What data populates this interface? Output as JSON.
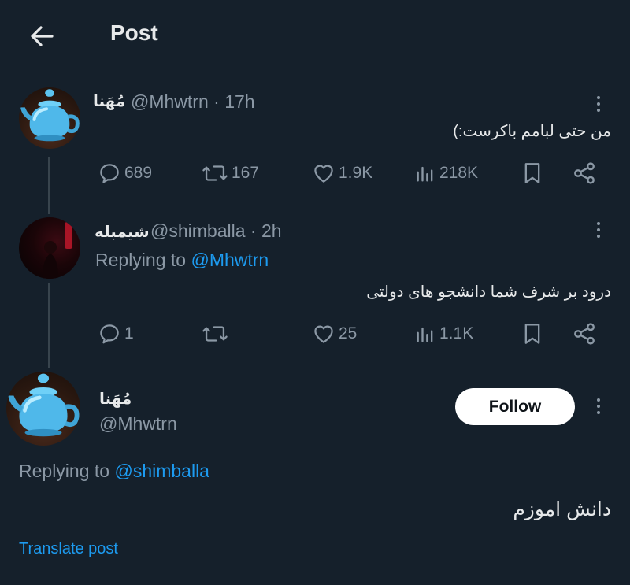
{
  "header": {
    "title": "Post",
    "back_icon": "arrow-left-icon"
  },
  "tweets": [
    {
      "name": "مُهَنا",
      "handle": "@Mhwtrn",
      "time": "· 17h",
      "avatar": "teapot",
      "text": "من حتی لبامم باکرست:)",
      "stats": {
        "replies": "689",
        "reposts": "167",
        "likes": "1.9K",
        "views": "218K"
      }
    },
    {
      "name": "شیمبله",
      "handle": "@shimballa",
      "time": "· 2h",
      "avatar": "dark",
      "replying_prefix": "Replying to",
      "replying_to": "@Mhwtrn",
      "text": "درود بر شرف شما دانشجو های دولتی",
      "stats": {
        "replies": "1",
        "reposts": "",
        "likes": "25",
        "views": "1.1K"
      }
    }
  ],
  "main": {
    "name": "مُهَنا",
    "handle": "@Mhwtrn",
    "follow_label": "Follow",
    "replying_prefix": "Replying to",
    "replying_to": "@shimballa",
    "text": "دانش اموزم",
    "translate_label": "Translate post"
  },
  "colors": {
    "background": "#15202b",
    "text": "#e7e9ea",
    "secondary": "#8b98a5",
    "accent": "#1d9bf0",
    "divider": "#38444d"
  }
}
